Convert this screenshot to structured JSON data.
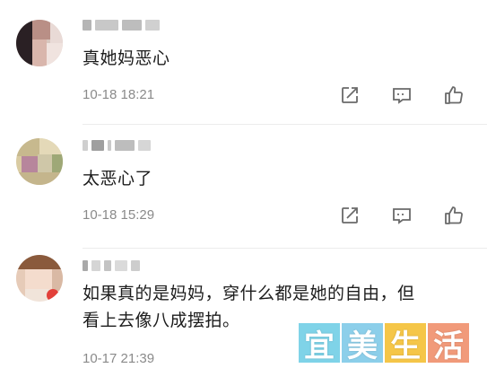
{
  "comments": [
    {
      "username": "",
      "text": "真她妈恶心",
      "time": "10-18 18:21"
    },
    {
      "username": "",
      "text": "太恶心了",
      "time": "10-18 15:29"
    },
    {
      "username": "",
      "text": "如果真的是妈妈，穿什么都是她的自由，但\n看上去像八成摆拍。",
      "time": "10-17 21:39"
    }
  ],
  "actions": {
    "repost_icon": "repost-icon",
    "comment_icon": "comment-icon",
    "like_icon": "like-icon"
  },
  "watermark": {
    "chars": [
      "宜",
      "美",
      "生",
      "活"
    ],
    "colors": [
      "#7fd3e8",
      "#8ccfea",
      "#f5c648",
      "#f19a7a"
    ]
  },
  "colors": {
    "time": "#8a8a8a",
    "icon": "#6a6a6a",
    "text": "#1c1c1c"
  }
}
